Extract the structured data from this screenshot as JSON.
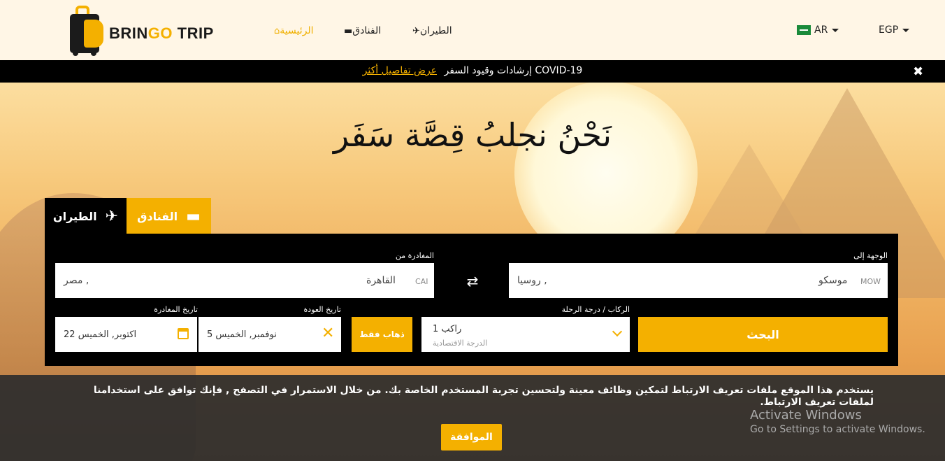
{
  "header": {
    "brand_part1": "BRIN",
    "brand_part2": "GO",
    "brand_part3": " TRIP",
    "nav": {
      "home": "الرئيسية",
      "hotels": "الفنادق",
      "flights": "الطيران"
    },
    "language": "AR",
    "currency": "EGP"
  },
  "covid_bar": {
    "message": "COVID-19 إرشادات وقيود السفر",
    "link": "عرض تفاصيل أكثر"
  },
  "hero": {
    "title": "نَحْنُ نجلبُ قِصَّة سَفَر"
  },
  "tabs": {
    "flights": "الطيران",
    "hotels": "الفنادق"
  },
  "form": {
    "to_label": "الوجهة إلى",
    "from_label": "المغادرة من",
    "to": {
      "code": "MOW",
      "city": "موسكو",
      "country": "روسيا ,"
    },
    "from": {
      "code": "CAI",
      "city": "القاهرة",
      "country": "مصر ,"
    },
    "passengers_label": "الركاب / درجة الرحلة",
    "return_label": "تاريخ العودة",
    "depart_label": "تاريخ المغادرة",
    "depart_date": "22 اكتوبر, الخميس",
    "return_date": "5 نوفمبر, الخميس",
    "oneway_button": "ذهاب فقط",
    "passengers": "راكب 1",
    "cabin_class": "الدرجة الاقتصادية",
    "search_button": "البحث"
  },
  "cookie": {
    "text": "يستخدم هذا الموقع ملفات تعريف الارتباط لتمكين وظائف معينة ولتحسين تجربة المستخدم الخاصة بك. من خلال الاستمرار في التصفح , فإنك توافق على استخدامنا لملفات تعريف الارتباط.",
    "accept_button": "الموافقة"
  },
  "watermark": {
    "line1": "Activate Windows",
    "line2": "Go to Settings to activate Windows."
  },
  "colors": {
    "accent": "#f4b000",
    "dark": "#000000"
  }
}
